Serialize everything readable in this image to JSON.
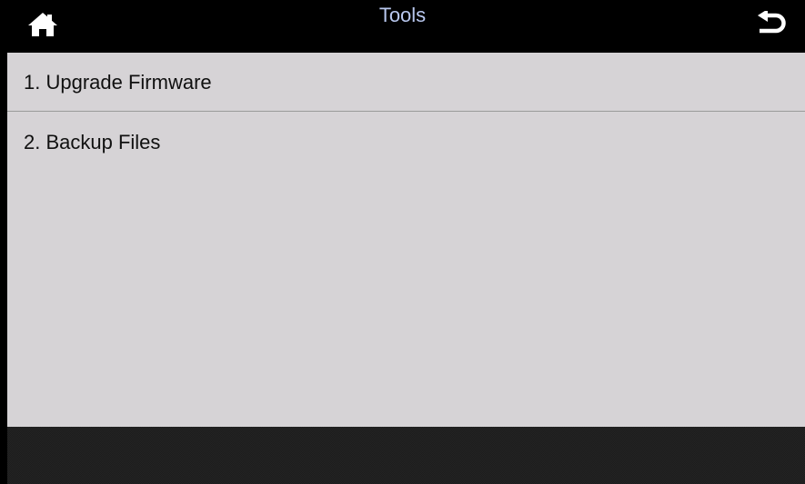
{
  "header": {
    "title": "Tools",
    "home_icon": "home-icon",
    "back_icon": "back-arrow-icon",
    "title_color": "#b9c8ef"
  },
  "menu": {
    "items": [
      {
        "label": "1. Upgrade Firmware"
      },
      {
        "label": "2. Backup Files"
      }
    ]
  },
  "colors": {
    "background": "#000000",
    "content": "#d6d3d6",
    "bottom_bar": "#1c1c1c",
    "divider": "#9a9a9a"
  }
}
